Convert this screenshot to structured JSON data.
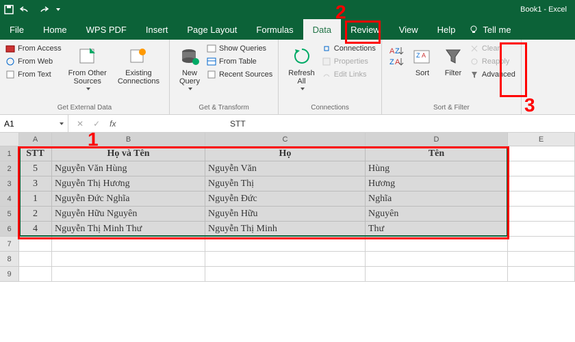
{
  "title": "Book1 - Excel",
  "tabs": [
    "File",
    "Home",
    "WPS PDF",
    "Insert",
    "Page Layout",
    "Formulas",
    "Data",
    "Review",
    "View",
    "Help"
  ],
  "active_tab": "Data",
  "tellme": "Tell me",
  "ribbon": {
    "ext": {
      "access": "From Access",
      "web": "From Web",
      "text": "From Text",
      "other": "From Other\nSources",
      "existing": "Existing\nConnections",
      "label": "Get External Data"
    },
    "gt": {
      "new": "New\nQuery",
      "show": "Show Queries",
      "table": "From Table",
      "recent": "Recent Sources",
      "label": "Get & Transform"
    },
    "conn": {
      "refresh": "Refresh\nAll",
      "conns": "Connections",
      "props": "Properties",
      "links": "Edit Links",
      "label": "Connections"
    },
    "sf": {
      "sort": "Sort",
      "filter": "Filter",
      "clear": "Clear",
      "reapply": "Reapply",
      "adv": "Advanced",
      "label": "Sort & Filter"
    }
  },
  "namebox": "A1",
  "fx_value": "STT",
  "cols": [
    "A",
    "B",
    "C",
    "D",
    "E"
  ],
  "data": {
    "h": {
      "stt": "STT",
      "name": "Họ và Tên",
      "ho": "Họ",
      "ten": "Tên"
    },
    "r": [
      {
        "stt": "5",
        "name": "Nguyễn Văn Hùng",
        "ho": "Nguyễn Văn",
        "ten": "Hùng"
      },
      {
        "stt": "3",
        "name": "Nguyễn Thị Hương",
        "ho": "Nguyễn Thị",
        "ten": "Hương"
      },
      {
        "stt": "1",
        "name": "Nguyễn Đức Nghĩa",
        "ho": "Nguyễn Đức",
        "ten": "Nghĩa"
      },
      {
        "stt": "2",
        "name": "Nguyễn Hữu Nguyên",
        "ho": "Nguyễn Hữu",
        "ten": "Nguyên"
      },
      {
        "stt": "4",
        "name": "Nguyễn Thị Minh Thư",
        "ho": "Nguyễn Thị Minh",
        "ten": "Thư"
      }
    ]
  },
  "annot": {
    "n1": "1",
    "n2": "2",
    "n3": "3"
  }
}
